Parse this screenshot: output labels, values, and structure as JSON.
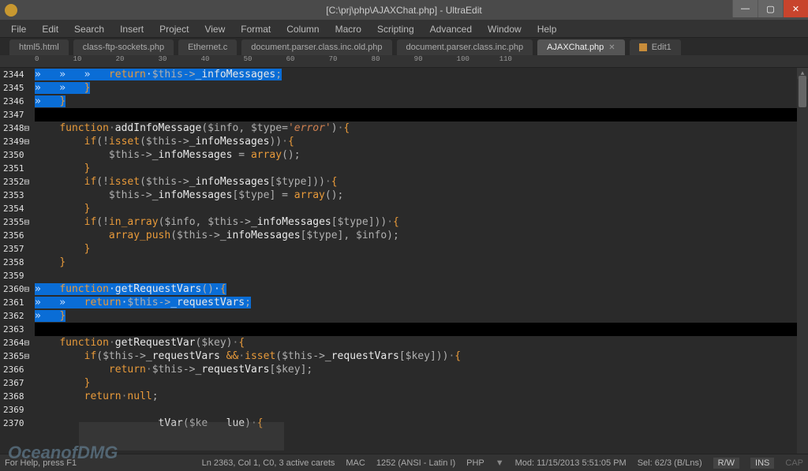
{
  "window": {
    "title": "[C:\\prj\\php\\AJAXChat.php] - UltraEdit"
  },
  "menu": {
    "items": [
      "File",
      "Edit",
      "Search",
      "Insert",
      "Project",
      "View",
      "Format",
      "Column",
      "Macro",
      "Scripting",
      "Advanced",
      "Window",
      "Help"
    ]
  },
  "tabs": {
    "items": [
      {
        "label": "html5.html",
        "active": false
      },
      {
        "label": "class-ftp-sockets.php",
        "active": false
      },
      {
        "label": "Ethernet.c",
        "active": false
      },
      {
        "label": "document.parser.class.inc.old.php",
        "active": false
      },
      {
        "label": "document.parser.class.inc.php",
        "active": false
      },
      {
        "label": "AJAXChat.php",
        "active": true,
        "closable": true
      },
      {
        "label": "Edit1",
        "active": false,
        "icon": true
      }
    ]
  },
  "ruler": {
    "marks": "0        10        20        30        40        50        60        70        80        90        100       110"
  },
  "gutter": {
    "start": 2344,
    "count": 27
  },
  "code": {
    "lines": [
      {
        "sel": true,
        "tokens": [
          [
            "ws",
            "»   »   »   "
          ],
          [
            "kw",
            "return"
          ],
          [
            "ws",
            "·"
          ],
          [
            "var",
            "$this"
          ],
          [
            "op",
            "->"
          ],
          [
            "fn",
            "_infoMessages"
          ],
          [
            "punc",
            ";"
          ]
        ]
      },
      {
        "sel": true,
        "tokens": [
          [
            "ws",
            "»   »   "
          ],
          [
            "brace",
            "}"
          ]
        ]
      },
      {
        "sel": true,
        "tokens": [
          [
            "ws",
            "»   "
          ],
          [
            "brace",
            "}"
          ]
        ]
      },
      {
        "cursor": true,
        "tokens": [
          [
            "ws",
            ""
          ]
        ]
      },
      {
        "tokens": [
          [
            "ws",
            "    "
          ],
          [
            "kw",
            "function"
          ],
          [
            "ws",
            "·"
          ],
          [
            "fn",
            "addInfoMessage"
          ],
          [
            "paren",
            "("
          ],
          [
            "var",
            "$info"
          ],
          [
            "punc",
            ", "
          ],
          [
            "var",
            "$type"
          ],
          [
            "op",
            "="
          ],
          [
            "str2",
            "'error'"
          ],
          [
            "paren",
            ")"
          ],
          [
            "ws",
            "·"
          ],
          [
            "brace",
            "{"
          ]
        ]
      },
      {
        "tokens": [
          [
            "ws",
            "        "
          ],
          [
            "kw",
            "if"
          ],
          [
            "paren",
            "("
          ],
          [
            "op",
            "!"
          ],
          [
            "func",
            "isset"
          ],
          [
            "paren",
            "("
          ],
          [
            "var",
            "$this"
          ],
          [
            "op",
            "->"
          ],
          [
            "fn",
            "_infoMessages"
          ],
          [
            "paren",
            "))"
          ],
          [
            "ws",
            "·"
          ],
          [
            "brace",
            "{"
          ]
        ]
      },
      {
        "tokens": [
          [
            "ws",
            "            "
          ],
          [
            "var",
            "$this"
          ],
          [
            "op",
            "->"
          ],
          [
            "fn",
            "_infoMessages"
          ],
          [
            "ws",
            " "
          ],
          [
            "op",
            "="
          ],
          [
            "ws",
            " "
          ],
          [
            "func",
            "array"
          ],
          [
            "paren",
            "()"
          ],
          [
            "punc",
            ";"
          ]
        ]
      },
      {
        "tokens": [
          [
            "ws",
            "        "
          ],
          [
            "brace",
            "}"
          ]
        ]
      },
      {
        "tokens": [
          [
            "ws",
            "        "
          ],
          [
            "kw",
            "if"
          ],
          [
            "paren",
            "("
          ],
          [
            "op",
            "!"
          ],
          [
            "func",
            "isset"
          ],
          [
            "paren",
            "("
          ],
          [
            "var",
            "$this"
          ],
          [
            "op",
            "->"
          ],
          [
            "fn",
            "_infoMessages"
          ],
          [
            "punc",
            "["
          ],
          [
            "var",
            "$type"
          ],
          [
            "punc",
            "]"
          ],
          [
            "paren",
            "))"
          ],
          [
            "ws",
            "·"
          ],
          [
            "brace",
            "{"
          ]
        ]
      },
      {
        "tokens": [
          [
            "ws",
            "            "
          ],
          [
            "var",
            "$this"
          ],
          [
            "op",
            "->"
          ],
          [
            "fn",
            "_infoMessages"
          ],
          [
            "punc",
            "["
          ],
          [
            "var",
            "$type"
          ],
          [
            "punc",
            "]"
          ],
          [
            "ws",
            " "
          ],
          [
            "op",
            "="
          ],
          [
            "ws",
            " "
          ],
          [
            "func",
            "array"
          ],
          [
            "paren",
            "()"
          ],
          [
            "punc",
            ";"
          ]
        ]
      },
      {
        "tokens": [
          [
            "ws",
            "        "
          ],
          [
            "brace",
            "}"
          ]
        ]
      },
      {
        "tokens": [
          [
            "ws",
            "        "
          ],
          [
            "kw",
            "if"
          ],
          [
            "paren",
            "("
          ],
          [
            "op",
            "!"
          ],
          [
            "func",
            "in_array"
          ],
          [
            "paren",
            "("
          ],
          [
            "var",
            "$info"
          ],
          [
            "punc",
            ", "
          ],
          [
            "var",
            "$this"
          ],
          [
            "op",
            "->"
          ],
          [
            "fn",
            "_infoMessages"
          ],
          [
            "punc",
            "["
          ],
          [
            "var",
            "$type"
          ],
          [
            "punc",
            "]"
          ],
          [
            "paren",
            "))"
          ],
          [
            "ws",
            "·"
          ],
          [
            "brace",
            "{"
          ]
        ]
      },
      {
        "tokens": [
          [
            "ws",
            "            "
          ],
          [
            "func",
            "array_push"
          ],
          [
            "paren",
            "("
          ],
          [
            "var",
            "$this"
          ],
          [
            "op",
            "->"
          ],
          [
            "fn",
            "_infoMessages"
          ],
          [
            "punc",
            "["
          ],
          [
            "var",
            "$type"
          ],
          [
            "punc",
            "]"
          ],
          [
            "punc",
            ", "
          ],
          [
            "var",
            "$info"
          ],
          [
            "paren",
            ")"
          ],
          [
            "punc",
            ";"
          ]
        ]
      },
      {
        "tokens": [
          [
            "ws",
            "        "
          ],
          [
            "brace",
            "}"
          ]
        ]
      },
      {
        "tokens": [
          [
            "ws",
            "    "
          ],
          [
            "brace",
            "}"
          ]
        ]
      },
      {
        "tokens": [
          [
            "ws",
            ""
          ]
        ]
      },
      {
        "sel": true,
        "tokens": [
          [
            "ws",
            "»   "
          ],
          [
            "kw",
            "function"
          ],
          [
            "ws",
            "·"
          ],
          [
            "fn",
            "getRequestVars"
          ],
          [
            "paren",
            "()"
          ],
          [
            "ws",
            "·"
          ],
          [
            "brace",
            "{"
          ]
        ]
      },
      {
        "sel": true,
        "tokens": [
          [
            "ws",
            "»   »   "
          ],
          [
            "kw",
            "return"
          ],
          [
            "ws",
            "·"
          ],
          [
            "var",
            "$this"
          ],
          [
            "op",
            "->"
          ],
          [
            "fn",
            "_requestVars"
          ],
          [
            "punc",
            ";"
          ]
        ]
      },
      {
        "sel": true,
        "tokens": [
          [
            "ws",
            "»   "
          ],
          [
            "brace",
            "}"
          ]
        ]
      },
      {
        "cursor": true,
        "tokens": [
          [
            "ws",
            ""
          ]
        ]
      },
      {
        "tokens": [
          [
            "ws",
            "    "
          ],
          [
            "kw",
            "function"
          ],
          [
            "ws",
            "·"
          ],
          [
            "fn",
            "getRequestVar"
          ],
          [
            "paren",
            "("
          ],
          [
            "var",
            "$key"
          ],
          [
            "paren",
            ")"
          ],
          [
            "ws",
            "·"
          ],
          [
            "brace",
            "{"
          ]
        ]
      },
      {
        "tokens": [
          [
            "ws",
            "        "
          ],
          [
            "kw",
            "if"
          ],
          [
            "paren",
            "("
          ],
          [
            "var",
            "$this"
          ],
          [
            "op",
            "->"
          ],
          [
            "fn",
            "_requestVars"
          ],
          [
            "ws",
            " "
          ],
          [
            "kw",
            "&&"
          ],
          [
            "ws",
            "·"
          ],
          [
            "func",
            "isset"
          ],
          [
            "paren",
            "("
          ],
          [
            "var",
            "$this"
          ],
          [
            "op",
            "->"
          ],
          [
            "fn",
            "_requestVars"
          ],
          [
            "punc",
            "["
          ],
          [
            "var",
            "$key"
          ],
          [
            "punc",
            "]"
          ],
          [
            "paren",
            "))"
          ],
          [
            "ws",
            "·"
          ],
          [
            "brace",
            "{"
          ]
        ]
      },
      {
        "tokens": [
          [
            "ws",
            "            "
          ],
          [
            "kw",
            "return"
          ],
          [
            "ws",
            "·"
          ],
          [
            "var",
            "$this"
          ],
          [
            "op",
            "->"
          ],
          [
            "fn",
            "_requestVars"
          ],
          [
            "punc",
            "["
          ],
          [
            "var",
            "$key"
          ],
          [
            "punc",
            "]"
          ],
          [
            "punc",
            ";"
          ]
        ]
      },
      {
        "tokens": [
          [
            "ws",
            "        "
          ],
          [
            "brace",
            "}"
          ]
        ]
      },
      {
        "tokens": [
          [
            "ws",
            "        "
          ],
          [
            "kw",
            "return"
          ],
          [
            "ws",
            "·"
          ],
          [
            "kw",
            "null"
          ],
          [
            "punc",
            ";"
          ]
        ]
      },
      {
        "tokens": [
          [
            "ws",
            ""
          ]
        ]
      },
      {
        "tokens": [
          [
            "ws",
            "                    "
          ],
          [
            "fn",
            "tVar"
          ],
          [
            "paren",
            "("
          ],
          [
            "var",
            "$ke"
          ],
          [
            "ws",
            "   "
          ],
          [
            "fn",
            "lue"
          ],
          [
            "paren",
            ")"
          ],
          [
            "ws",
            "·"
          ],
          [
            "brace",
            "{"
          ]
        ]
      }
    ],
    "foldable": [
      4,
      5,
      8,
      11,
      16,
      20,
      21
    ]
  },
  "status": {
    "help": "For Help, press F1",
    "pos": "Ln 2363, Col 1, C0, 3 active carets",
    "lineend": "MAC",
    "encoding": "1252  (ANSI - Latin I)",
    "lang": "PHP",
    "mod": "Mod: 11/15/2013 5:51:05 PM",
    "sel": "Sel: 62/3 (B/Lns)",
    "rw": "R/W",
    "ins": "INS",
    "cap": "CAP"
  },
  "watermark": "OceanofDMG"
}
